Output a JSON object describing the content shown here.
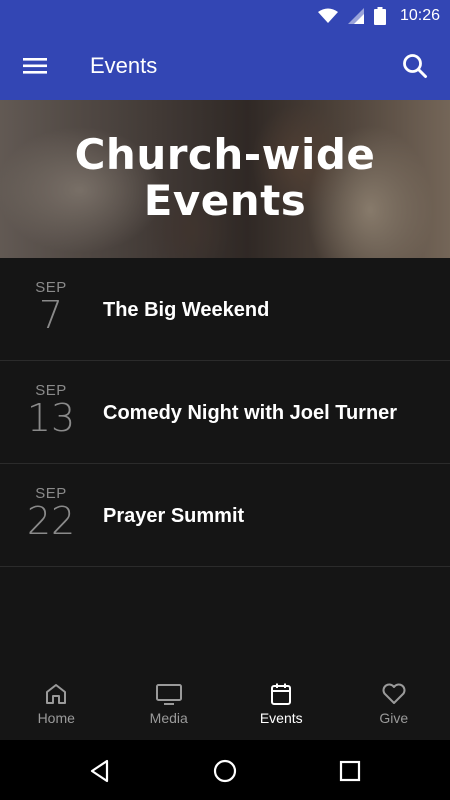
{
  "status_bar": {
    "time": "10:26"
  },
  "app_bar": {
    "title": "Events"
  },
  "hero": {
    "title": "Church-wide\nEvents"
  },
  "events": [
    {
      "month": "SEP",
      "day": "7",
      "name": "The Big Weekend"
    },
    {
      "month": "SEP",
      "day": "13",
      "name": "Comedy Night with Joel Turner"
    },
    {
      "month": "SEP",
      "day": "22",
      "name": "Prayer Summit"
    }
  ],
  "bottom_nav": [
    {
      "label": "Home",
      "icon": "home-icon",
      "active": false
    },
    {
      "label": "Media",
      "icon": "tv-icon",
      "active": false
    },
    {
      "label": "Events",
      "icon": "calendar-icon",
      "active": true
    },
    {
      "label": "Give",
      "icon": "heart-icon",
      "active": false
    }
  ],
  "colors": {
    "app_bar": "#3346b4",
    "background": "#151515",
    "inactive": "#9a9a9a"
  }
}
